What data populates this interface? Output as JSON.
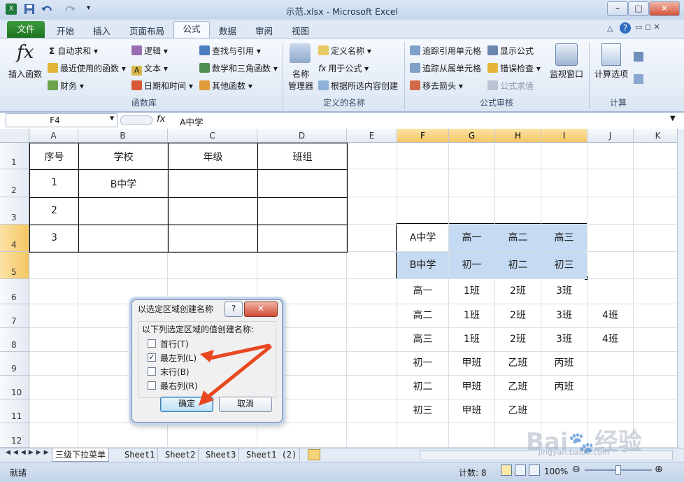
{
  "window": {
    "title": "示范.xlsx - Microsoft Excel",
    "min": "–",
    "max": "□",
    "close": "✕"
  },
  "tabs": [
    "开始",
    "插入",
    "页面布局",
    "公式",
    "数据",
    "审阅",
    "视图"
  ],
  "file_tab": "文件",
  "ribbon": {
    "insert_function": "插入函数",
    "autosum": "自动求和 ▾",
    "recent": "最近使用的函数 ▾",
    "finance": "财务 ▾",
    "logic": "逻辑 ▾",
    "text": "文本 ▾",
    "datetime": "日期和时间 ▾",
    "lookup": "查找与引用 ▾",
    "math": "数学和三角函数 ▾",
    "other": "其他函数 ▾",
    "group_library": "函数库",
    "name_manager_1": "名称",
    "name_manager_2": "管理器",
    "define_name": "定义名称 ▾",
    "use_in_formula": "用于公式 ▾",
    "create_from_sel": "根据所选内容创建",
    "group_defined": "定义的名称",
    "trace_precedents": "追踪引用单元格",
    "trace_dependents": "追踪从属单元格",
    "remove_arrows": "移去箭头 ▾",
    "show_formulas": "显示公式",
    "error_check": "错误检查 ▾",
    "evaluate": "公式求值",
    "watch_window": "监视窗口",
    "group_audit": "公式审核",
    "calc_options": "计算选项",
    "group_calc": "计算"
  },
  "formula_bar": {
    "name_box": "F4",
    "fx": "fx",
    "content": "A中学"
  },
  "columns": [
    "A",
    "B",
    "C",
    "D",
    "E",
    "F",
    "G",
    "H",
    "I",
    "J",
    "K"
  ],
  "rows": [
    "1",
    "2",
    "3",
    "4",
    "5",
    "6",
    "7",
    "8",
    "9",
    "10",
    "11",
    "12"
  ],
  "table_left": {
    "headers": [
      "序号",
      "学校",
      "年级",
      "班组"
    ],
    "rows": [
      [
        "1",
        "B中学",
        "",
        ""
      ],
      [
        "2",
        "",
        "",
        ""
      ],
      [
        "3",
        "",
        "",
        ""
      ]
    ]
  },
  "table_right": [
    [
      "A中学",
      "高一",
      "高二",
      "高三",
      ""
    ],
    [
      "B中学",
      "初一",
      "初二",
      "初三",
      ""
    ],
    [
      "高一",
      "1班",
      "2班",
      "3班",
      ""
    ],
    [
      "高二",
      "1班",
      "2班",
      "3班",
      "4班"
    ],
    [
      "高三",
      "1班",
      "2班",
      "3班",
      "4班"
    ],
    [
      "初一",
      "甲班",
      "乙班",
      "丙班",
      ""
    ],
    [
      "初二",
      "甲班",
      "乙班",
      "丙班",
      ""
    ],
    [
      "初三",
      "甲班",
      "乙班",
      "",
      ""
    ]
  ],
  "dialog": {
    "title": "以选定区域创建名称",
    "help": "?",
    "close": "✕",
    "prompt": "以下列选定区域的值创建名称:",
    "options": [
      {
        "label": "首行(T)",
        "checked": false
      },
      {
        "label": "最左列(L)",
        "checked": true
      },
      {
        "label": "末行(B)",
        "checked": false
      },
      {
        "label": "最右列(R)",
        "checked": false
      }
    ],
    "ok": "确定",
    "cancel": "取消"
  },
  "sheet_tabs": [
    "三级下拉菜单",
    "Sheet1",
    "Sheet2",
    "Sheet3",
    "Sheet1 (2)"
  ],
  "status": {
    "ready": "就绪",
    "count": "计数: 8",
    "zoom": "100%"
  },
  "colors": {
    "selection_fill": "#c5dbf3",
    "arrow": "#e8471f",
    "file_tab": "#2a8a2a"
  }
}
